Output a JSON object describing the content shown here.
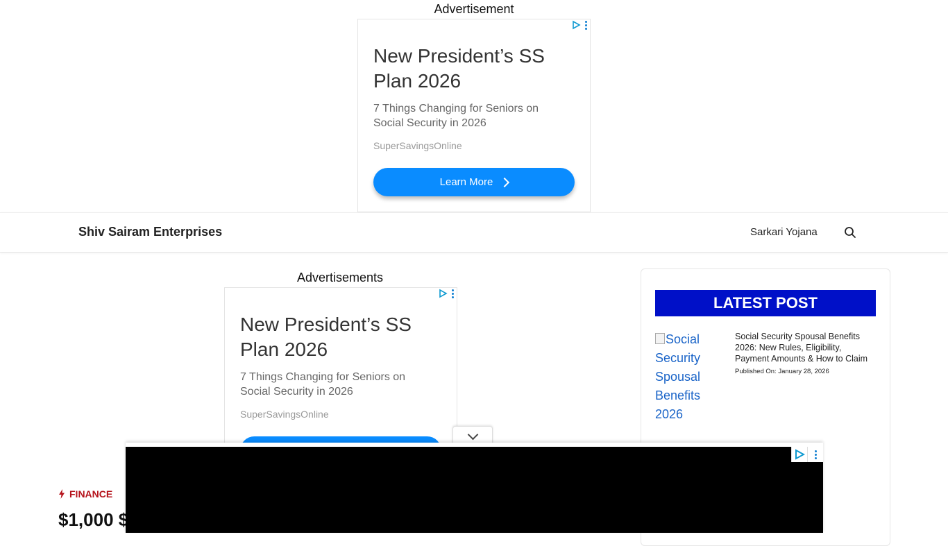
{
  "top_ad": {
    "label": "Advertisement",
    "headline": "New President’s SS Plan 2026",
    "subtext": "7 Things Changing for Seniors on Social Security in 2026",
    "source": "SuperSavingsOnline",
    "cta": "Learn More"
  },
  "header": {
    "brand": "Shiv Sairam Enterprises",
    "nav_item": "Sarkari Yojana"
  },
  "content_ad": {
    "label": "Advertisements",
    "headline": "New President’s SS Plan 2026",
    "subtext": "7 Things Changing for Seniors on Social Security in 2026",
    "source": "SuperSavingsOnline"
  },
  "sidebar": {
    "heading": "LATEST POST",
    "posts": [
      {
        "image_alt": "Social Security Spousal Benefits 2026",
        "title": "Social Security Spousal Benefits 2026: New Rules, Eligibility, Payment Amounts & How to Claim",
        "date": "Published On: January 28, 2026"
      }
    ]
  },
  "article": {
    "category": "FINANCE",
    "title_partial": "$1,000 $"
  },
  "colors": {
    "ad_button": "#0a8cff",
    "latest_bar": "#0010c8",
    "category": "#b5121b",
    "link": "#1a64c8"
  }
}
